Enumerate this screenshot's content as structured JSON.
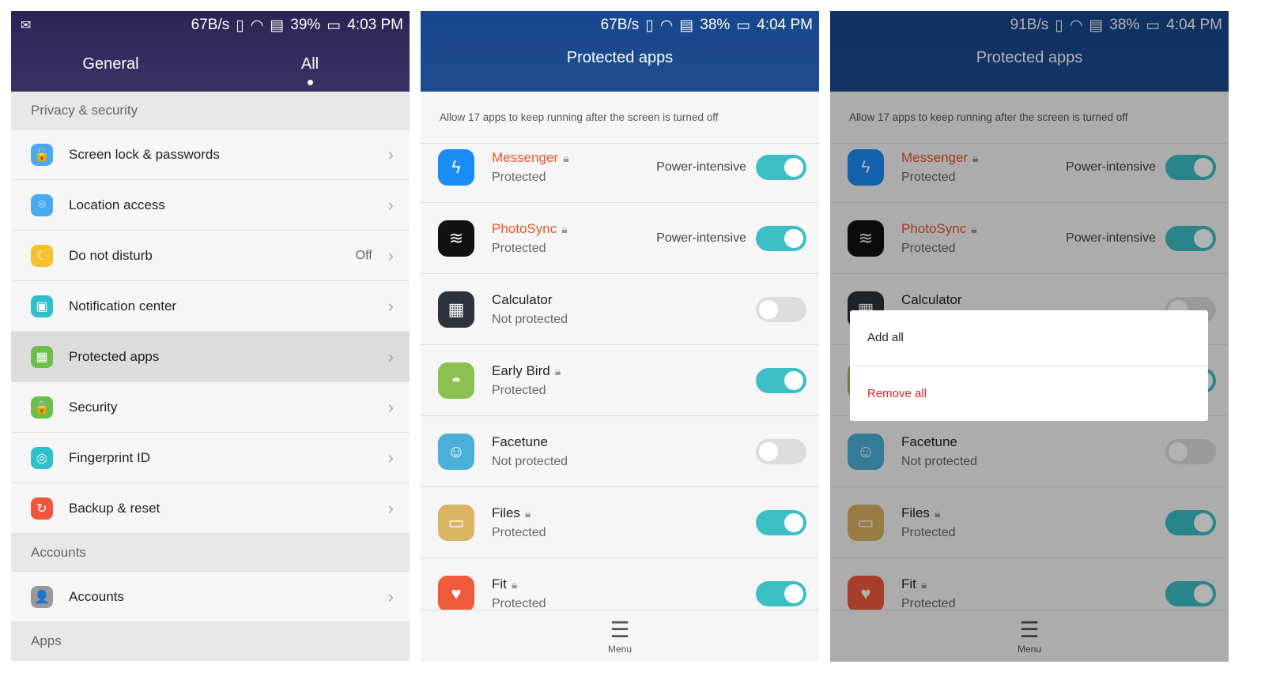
{
  "screen1": {
    "status": {
      "speed": "67B/s",
      "battery": "39%",
      "time": "4:03 PM"
    },
    "tabs": [
      {
        "label": "General"
      },
      {
        "label": "All",
        "active": true
      }
    ],
    "sections": [
      {
        "title": "Privacy & security"
      },
      {
        "title": "Accounts"
      },
      {
        "title": "Apps"
      }
    ],
    "items": [
      {
        "label": "Screen lock & passwords",
        "icon": "lock-open-icon",
        "color": "#4aa9f0",
        "glyph": "🔓"
      },
      {
        "label": "Location access",
        "icon": "location-pin-icon",
        "color": "#4aa9f0",
        "glyph": "⌾"
      },
      {
        "label": "Do not disturb",
        "icon": "moon-icon",
        "color": "#f6c02f",
        "glyph": "☾",
        "value": "Off"
      },
      {
        "label": "Notification center",
        "icon": "notification-icon",
        "color": "#2fc1c9",
        "glyph": "▣"
      },
      {
        "label": "Protected apps",
        "icon": "apps-grid-icon",
        "color": "#6cc04a",
        "glyph": "▦",
        "highlighted": true
      },
      {
        "label": "Security",
        "icon": "padlock-icon",
        "color": "#6cc04a",
        "glyph": "🔒"
      },
      {
        "label": "Fingerprint ID",
        "icon": "fingerprint-icon",
        "color": "#2fc1c9",
        "glyph": "◎"
      },
      {
        "label": "Backup & reset",
        "icon": "backup-icon",
        "color": "#f0563e",
        "glyph": "↻"
      },
      {
        "label": "Accounts",
        "icon": "account-icon",
        "color": "#999999",
        "glyph": "👤"
      }
    ]
  },
  "screen2": {
    "status": {
      "speed": "67B/s",
      "battery": "38%",
      "time": "4:04 PM"
    }
  },
  "screen3": {
    "status": {
      "speed": "91B/s",
      "battery": "38%",
      "time": "4:04 PM"
    },
    "dialog": {
      "add_all": "Add all",
      "remove_all": "Remove all"
    }
  },
  "protected": {
    "title": "Protected apps",
    "description": "Allow 17 apps to keep running after the screen is turned off",
    "power_label": "Power-intensive",
    "menu_label": "Menu",
    "apps": [
      {
        "name": "Messenger",
        "status": "Protected",
        "on": true,
        "power": true,
        "locked": true,
        "icon": "messenger-icon",
        "color": "#1a8cf5",
        "glyph": "ϟ"
      },
      {
        "name": "PhotoSync",
        "status": "Protected",
        "on": true,
        "power": true,
        "locked": true,
        "icon": "photosync-icon",
        "color": "#111111",
        "glyph": "≋"
      },
      {
        "name": "Calculator",
        "status": "Not protected",
        "on": false,
        "icon": "calculator-icon",
        "color": "#2c333d",
        "glyph": "▦"
      },
      {
        "name": "Early Bird",
        "status": "Protected",
        "on": true,
        "locked": true,
        "icon": "android-icon",
        "color": "#8cc152",
        "glyph": "◓"
      },
      {
        "name": "Facetune",
        "status": "Not protected",
        "on": false,
        "icon": "facetune-icon",
        "color": "#4ab0d9",
        "glyph": "☺"
      },
      {
        "name": "Files",
        "status": "Protected",
        "on": true,
        "locked": true,
        "icon": "folder-icon",
        "color": "#d9b463",
        "glyph": "▭"
      },
      {
        "name": "Fit",
        "status": "Protected",
        "on": true,
        "locked": true,
        "icon": "heart-icon",
        "color": "#ef5a3b",
        "glyph": "♥"
      }
    ]
  },
  "colors": {
    "toggle_on": "#3bbfc4",
    "accent_orange": "#e8582a",
    "danger": "#d5261e"
  }
}
